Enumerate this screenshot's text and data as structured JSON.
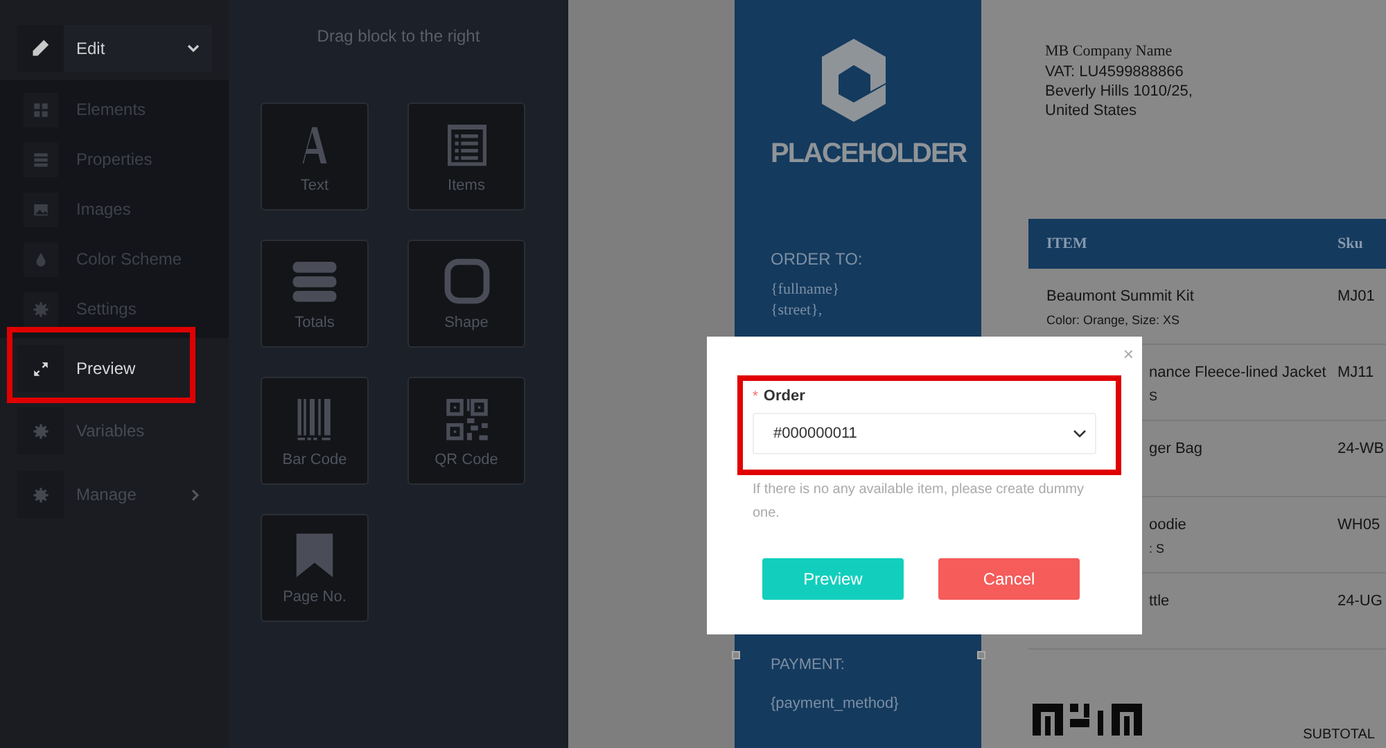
{
  "sidebar": {
    "header": {
      "label": "Edit",
      "expanded": true
    },
    "items": [
      {
        "label": "Elements",
        "selected": false
      },
      {
        "label": "Properties",
        "selected": false
      },
      {
        "label": "Images",
        "selected": false
      },
      {
        "label": "Color Scheme",
        "selected": false
      },
      {
        "label": "Settings",
        "selected": false
      }
    ],
    "top_items": [
      {
        "label": "Preview",
        "selected": true,
        "highlighted": true
      },
      {
        "label": "Variables",
        "selected": false
      },
      {
        "label": "Manage",
        "selected": false,
        "submenu": true
      }
    ]
  },
  "blocks_panel": {
    "hint": "Drag block to the right",
    "blocks": [
      {
        "label": "Text"
      },
      {
        "label": "Items"
      },
      {
        "label": "Totals"
      },
      {
        "label": "Shape"
      },
      {
        "label": "Bar Code"
      },
      {
        "label": "QR Code"
      },
      {
        "label": "Page No."
      }
    ]
  },
  "document": {
    "logo_text": "PLACEHOLDER",
    "order_to_label": "ORDER TO:",
    "order_to_lines": [
      "{fullname}",
      "{street},"
    ],
    "payment_label": "PAYMENT:",
    "payment_value": "{payment_method}",
    "company_lines": [
      "MB Company Name",
      "VAT: LU4599888866",
      "Beverly Hills 1010/25,",
      "United States"
    ],
    "table": {
      "columns": [
        "ITEM",
        "Sku"
      ],
      "rows": [
        {
          "kind": "full",
          "item": "Beaumont Summit Kit",
          "detail": "Color: Orange, Size: XS",
          "sku": "MJ01"
        },
        {
          "kind": "partial",
          "item": "nance Fleece-lined Jacket",
          "detail": "S",
          "sku": "MJ11"
        },
        {
          "kind": "partial",
          "item": "ger Bag",
          "sku": "24-WB"
        },
        {
          "kind": "partial",
          "item": "oodie",
          "detail": ": S",
          "sku": "WH05"
        },
        {
          "kind": "partial",
          "item": "ttle",
          "sku": "24-UG"
        }
      ]
    },
    "subtotal_label": "SUBTOTAL"
  },
  "dialog": {
    "close": "×",
    "field": {
      "label": "Order",
      "required_mark": "*",
      "value": "#000000011",
      "highlighted": true
    },
    "help": "If there is no any available item, please create dummy one.",
    "buttons": [
      {
        "label": "Preview",
        "kind": "primary"
      },
      {
        "label": "Cancel",
        "kind": "danger"
      }
    ]
  }
}
